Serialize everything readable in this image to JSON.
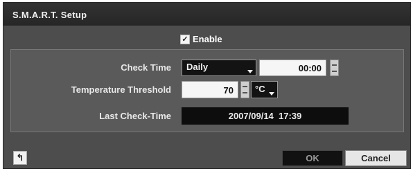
{
  "dialog": {
    "title": "S.M.A.R.T. Setup",
    "enable_label": "Enable",
    "enable_checked": true
  },
  "check_time": {
    "label": "Check Time",
    "frequency": "Daily",
    "time": "00:00"
  },
  "temperature": {
    "label": "Temperature Threshold",
    "value": "70",
    "unit": "°C"
  },
  "last_check": {
    "label": "Last Check-Time",
    "value": "2007/09/14  17:39"
  },
  "buttons": {
    "ok": "OK",
    "cancel": "Cancel",
    "back_icon": "return-arrow-icon"
  }
}
